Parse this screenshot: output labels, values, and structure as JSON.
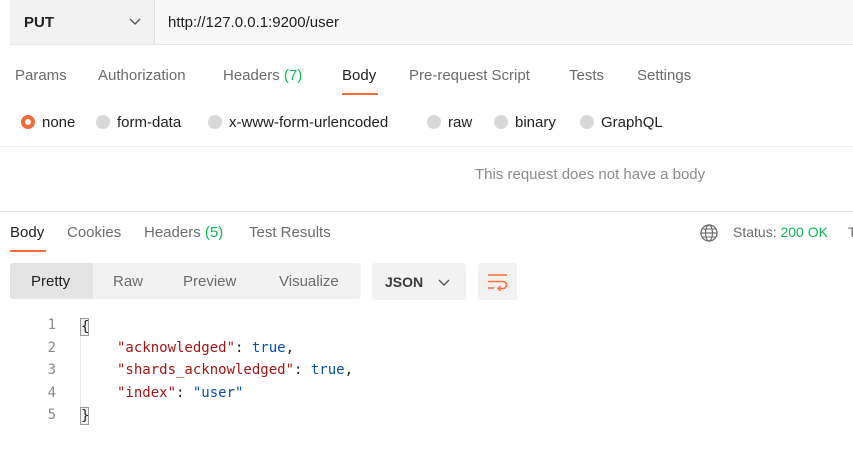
{
  "request": {
    "method": "PUT",
    "url": "http://127.0.0.1:9200/user",
    "tabs": [
      {
        "label": "Params"
      },
      {
        "label": "Authorization"
      },
      {
        "label": "Headers",
        "count": "(7)"
      },
      {
        "label": "Body"
      },
      {
        "label": "Pre-request Script"
      },
      {
        "label": "Tests"
      },
      {
        "label": "Settings"
      }
    ],
    "active_tab": "Body",
    "body_types": [
      {
        "label": "none",
        "selected": true
      },
      {
        "label": "form-data"
      },
      {
        "label": "x-www-form-urlencoded"
      },
      {
        "label": "raw"
      },
      {
        "label": "binary"
      },
      {
        "label": "GraphQL"
      }
    ],
    "empty_body_message": "This request does not have a body"
  },
  "response": {
    "tabs": [
      {
        "label": "Body"
      },
      {
        "label": "Cookies"
      },
      {
        "label": "Headers",
        "count": "(5)"
      },
      {
        "label": "Test Results"
      }
    ],
    "active_tab": "Body",
    "status_label": "Status:",
    "status_value": "200 OK",
    "status_trailing": "T",
    "view_modes": [
      {
        "label": "Pretty"
      },
      {
        "label": "Raw"
      },
      {
        "label": "Preview"
      },
      {
        "label": "Visualize"
      }
    ],
    "active_view": "Pretty",
    "format": "JSON",
    "code_lines": [
      "1",
      "2",
      "3",
      "4",
      "5"
    ],
    "json": {
      "open": "{",
      "close": "}",
      "k1": "\"acknowledged\"",
      "v1": "true",
      "k2": "\"shards_acknowledged\"",
      "v2": "true",
      "k3": "\"index\"",
      "v3": "\"user\"",
      "colon": ": ",
      "comma": ","
    }
  },
  "icons": {
    "method_dropdown": "chevron-down-icon",
    "globe": "globe-icon",
    "format_dropdown": "chevron-down-icon",
    "wrap": "wrap-lines-icon"
  },
  "colors": {
    "accent": "#ff6c37",
    "success": "#0cbb52",
    "radio_selected": "#f26b3a",
    "json_key": "#a31515",
    "json_value": "#0451a5"
  }
}
